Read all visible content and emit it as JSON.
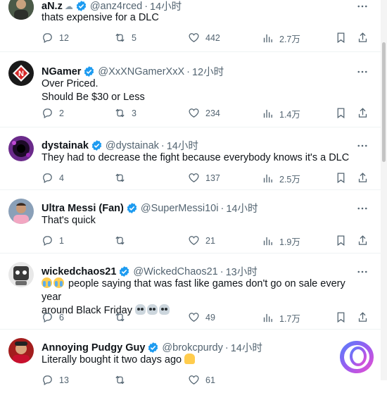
{
  "tweets": [
    {
      "name": "aN.z",
      "handle": "@anz4rced",
      "time": "14小时",
      "text": [
        "thats expensive for a DLC"
      ],
      "replies": "12",
      "reposts": "5",
      "likes": "442",
      "views": "2.7万",
      "name_suffix_icon": "cloud-icon"
    },
    {
      "name": "NGamer",
      "handle": "@XxXNGamerXxX",
      "time": "12小时",
      "text": [
        "Over Priced.",
        "Should Be $30 or Less"
      ],
      "replies": "2",
      "reposts": "3",
      "likes": "234",
      "views": "1.4万"
    },
    {
      "name": "dystainak",
      "handle": "@dystainak",
      "time": "14小时",
      "text": [
        "They had to decrease the fight because everybody knows it's a DLC"
      ],
      "replies": "4",
      "reposts": "",
      "likes": "137",
      "views": "2.5万"
    },
    {
      "name": "Ultra Messi (Fan)",
      "handle": "@SuperMessi10i",
      "time": "14小时",
      "text": [
        "That's quick"
      ],
      "replies": "1",
      "reposts": "",
      "likes": "21",
      "views": "1.9万"
    },
    {
      "name": "wickedchaos21",
      "handle": "@WickedChaos21",
      "time": "13小时",
      "text": [
        "people saying that was fast like games don't go on sale every year",
        "around Black Friday"
      ],
      "replies": "6",
      "reposts": "",
      "likes": "49",
      "views": "1.7万"
    },
    {
      "name": "Annoying Pudgy Guy",
      "handle": "@brokcpurdy",
      "time": "14小时",
      "text": [
        "Literally bought it two days ago"
      ],
      "replies": "13",
      "reposts": "",
      "likes": "61",
      "views": ""
    }
  ],
  "colors": {
    "verified": "#1d9bf0",
    "secondary": "#536471",
    "text": "#0f1419"
  }
}
